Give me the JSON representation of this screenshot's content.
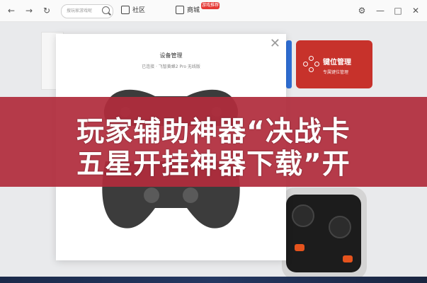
{
  "titlebar": {
    "back": "←",
    "forward": "→",
    "refresh": "↻",
    "search_placeholder": "搜玩家游戏呢",
    "nav_community": "社区",
    "nav_store": "商城",
    "store_badge": "游戏推荐",
    "settings": "⚙",
    "minimize": "—",
    "maximize": "□",
    "close": "✕"
  },
  "cards": {
    "keymap_title": "键位管理",
    "keymap_sub": "专属键位管理"
  },
  "modal": {
    "title": "设备管理",
    "subtitle": "已连接 · 飞智黄蜂2 Pro 无线版",
    "close": "✕"
  },
  "overlay": {
    "line1": "玩家辅助神器“决战卡",
    "line2": "五星开挂神器下载”开"
  },
  "colors": {
    "accent_red": "#c7322b",
    "accent_blue": "#2f6fd6",
    "banner": "#b02c3c"
  }
}
